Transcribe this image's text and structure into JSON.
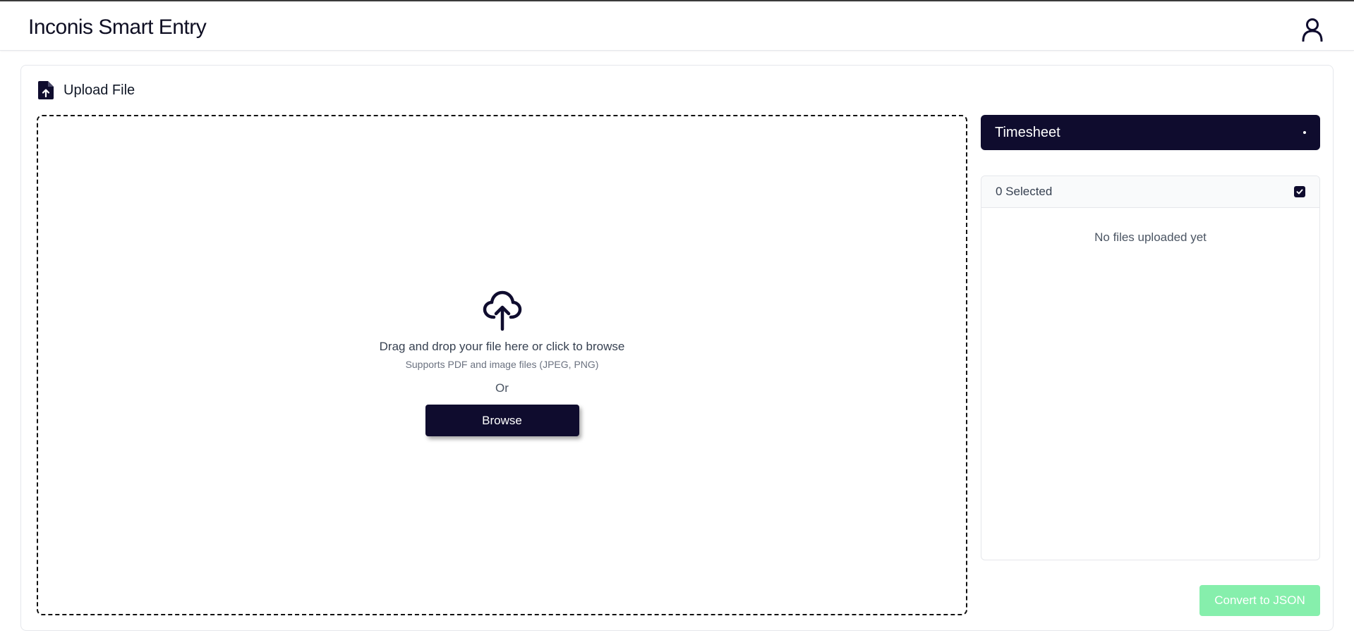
{
  "header": {
    "app_title": "Inconis Smart Entry",
    "user_icon": "user-icon"
  },
  "upload": {
    "section_title": "Upload File",
    "section_icon": "file-upload-icon",
    "dropzone": {
      "icon": "cloud-upload-icon",
      "title": "Drag and drop your file here or click to browse",
      "subtitle": "Supports PDF and image files (JPEG, PNG)",
      "or_text": "Or",
      "browse_label": "Browse"
    }
  },
  "document_type": {
    "selected": "Timesheet"
  },
  "files": {
    "selected_count_text": "0 Selected",
    "select_all_checked": true,
    "empty_text": "No files uploaded yet"
  },
  "actions": {
    "convert_label": "Convert to JSON"
  },
  "colors": {
    "primary": "#0f0c2e",
    "convert_disabled": "#86efac"
  }
}
